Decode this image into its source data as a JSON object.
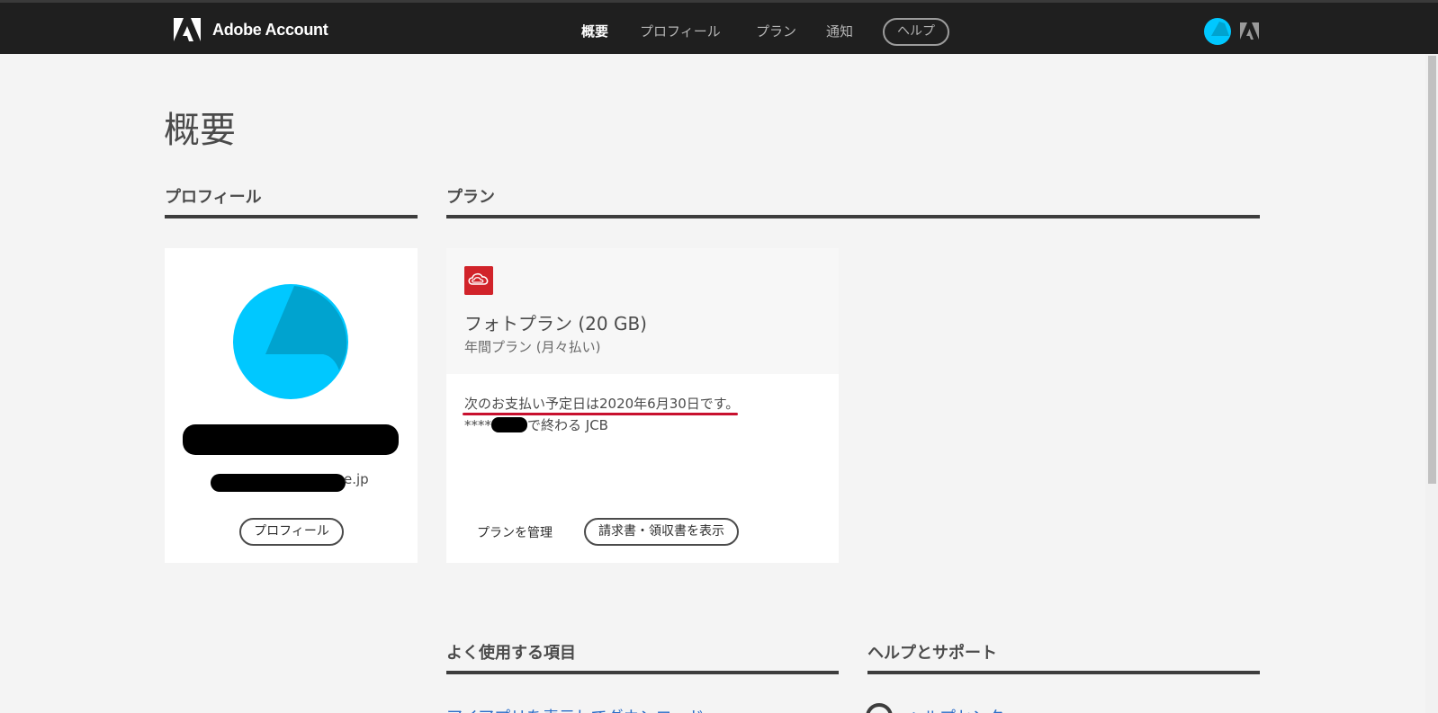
{
  "header": {
    "brand_name": "Adobe Account",
    "nav": [
      {
        "label": "概要",
        "active": true
      },
      {
        "label": "プロフィール",
        "active": false
      },
      {
        "label": "プラン",
        "active": false
      },
      {
        "label": "通知",
        "active": false
      }
    ],
    "help_label": "ヘルプ"
  },
  "page": {
    "title": "概要"
  },
  "profile": {
    "section_title": "プロフィール",
    "email_suffix": "e.jp",
    "button_label": "プロフィール"
  },
  "plan": {
    "section_title": "プラン",
    "name": "フォトプラン (20 GB)",
    "billing_type": "年間プラン (月々払い)",
    "next_payment": "次のお支払い予定日は2020年6月30日です。",
    "card_prefix": "****",
    "card_suffix": "で終わる JCB",
    "manage_label": "プランを管理",
    "invoice_label": "請求書・領収書を表示"
  },
  "frequent": {
    "section_title": "よく使用する項目",
    "first_link": "アイアプリを表示してダウンロード"
  },
  "support": {
    "section_title": "ヘルプとサポート",
    "first_link": "ヘルプセンター"
  },
  "colors": {
    "header_bg": "#1f1f1f",
    "accent_red": "#c8102e",
    "link_blue": "#2d6ec8",
    "avatar_cyan": "#00c8ff"
  },
  "icons": [
    "adobe-logo-icon",
    "avatar-icon",
    "creative-cloud-icon",
    "help-circle-icon"
  ]
}
